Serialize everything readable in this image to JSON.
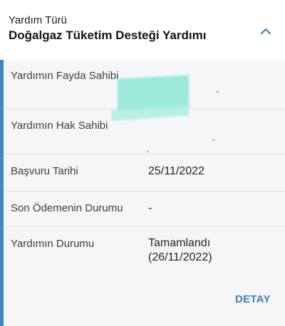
{
  "header": {
    "title": "Yardım Türü",
    "subtitle": "Doğalgaz Tüketim Desteği Yardımı",
    "collapse_icon": "chevron-up-icon"
  },
  "rows": [
    {
      "label": "Yardımın Fayda Sahibi",
      "value": ""
    },
    {
      "label": "Yardımın Hak Sahibi",
      "value": ""
    },
    {
      "label": "Başvuru Tarihi",
      "value": "25/11/2022"
    },
    {
      "label": "Son Ödemenin Durumu",
      "value": "-"
    },
    {
      "label": "Yardımın Durumu",
      "value_line1": "Tamamlandı",
      "value_line2": "(26/11/2022)"
    }
  ],
  "action": {
    "detail_label": "DETAY"
  },
  "colors": {
    "accent": "#3f88c5",
    "link": "#3f7fb5",
    "redaction": "#8fe8d8"
  }
}
